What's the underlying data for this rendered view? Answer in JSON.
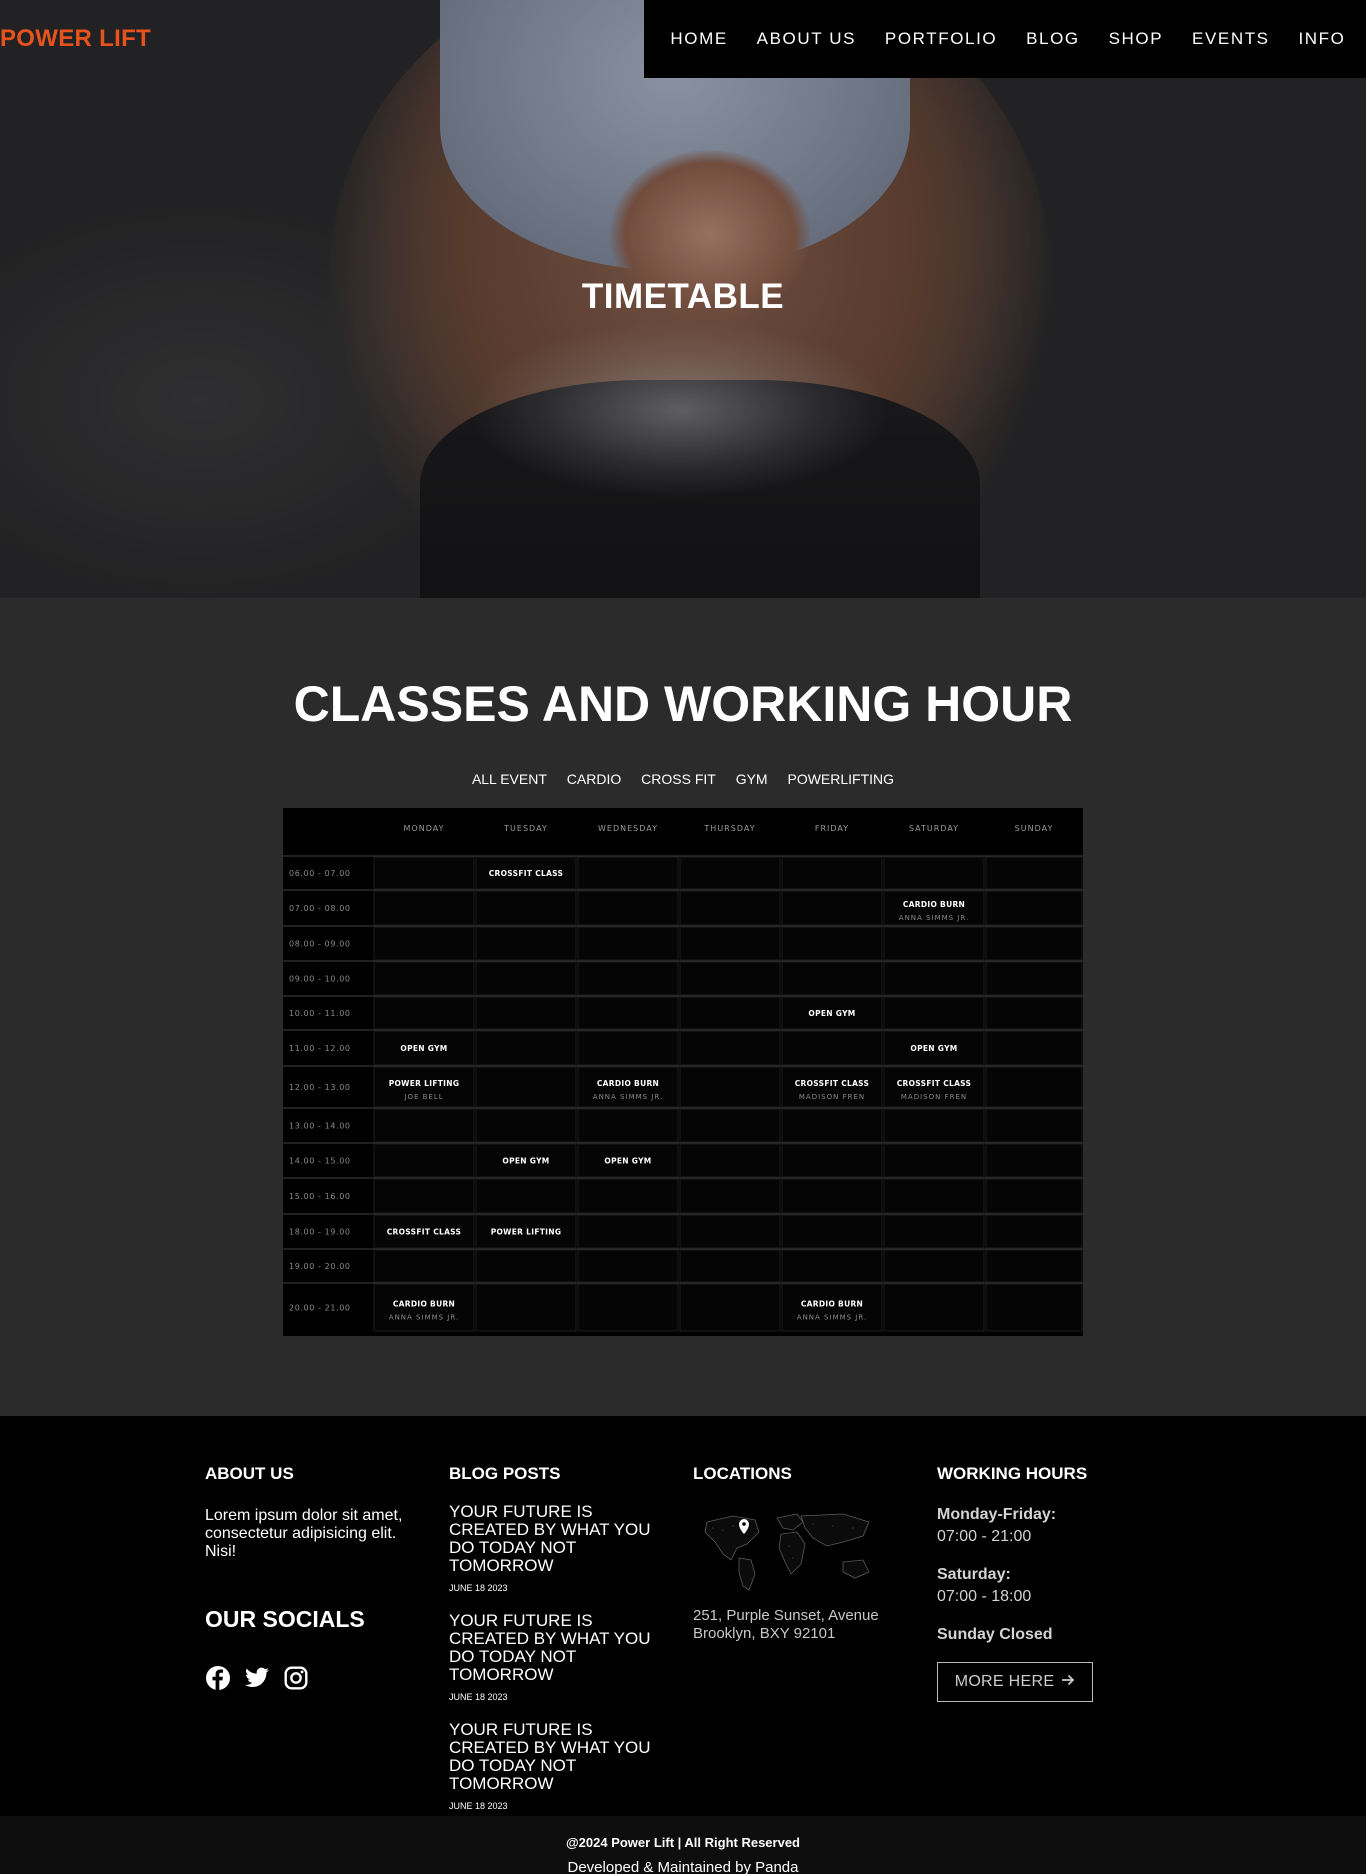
{
  "brand": {
    "logo": "POWER LIFT",
    "logo_color": "#e8531d"
  },
  "nav": {
    "items": [
      "HOME",
      "ABOUT US",
      "PORTFOLIO",
      "BLOG",
      "SHOP",
      "EVENTS",
      "INFO"
    ]
  },
  "hero": {
    "title": "TIMETABLE"
  },
  "section": {
    "title": "CLASSES AND WORKING HOUR"
  },
  "filters": [
    "ALL EVENT",
    "CARDIO",
    "CROSS FIT",
    "GYM",
    "POWERLIFTING"
  ],
  "timetable": {
    "days": [
      "MONDAY",
      "TUESDAY",
      "WEDNESDAY",
      "THURSDAY",
      "FRIDAY",
      "SATURDAY",
      "SUNDAY"
    ],
    "times": [
      "06.00 - 07.00",
      "07.00 - 08.00",
      "08.00 - 09.00",
      "09.00 - 10.00",
      "10.00 - 11.00",
      "11.00 - 12.00",
      "12.00 - 13.00",
      "13.00 - 14.00",
      "14.00 - 15.00",
      "15.00 - 16.00",
      "18.00 - 19.00",
      "19.00 - 20.00",
      "20.00 - 21.00"
    ],
    "events": [
      {
        "day": 1,
        "row": 0,
        "title": "CROSSFIT CLASS",
        "trainer": ""
      },
      {
        "day": 5,
        "row": 1,
        "title": "CARDIO BURN",
        "trainer": "ANNA SIMMS JR."
      },
      {
        "day": 4,
        "row": 4,
        "title": "OPEN GYM",
        "trainer": ""
      },
      {
        "day": 0,
        "row": 5,
        "title": "OPEN GYM",
        "trainer": ""
      },
      {
        "day": 5,
        "row": 5,
        "title": "OPEN GYM",
        "trainer": ""
      },
      {
        "day": 0,
        "row": 6,
        "title": "POWER LIFTING",
        "trainer": "JOE BELL"
      },
      {
        "day": 2,
        "row": 6,
        "title": "CARDIO BURN",
        "trainer": "ANNA SIMMS JR."
      },
      {
        "day": 4,
        "row": 6,
        "title": "CROSSFIT CLASS",
        "trainer": "MADISON FREN"
      },
      {
        "day": 5,
        "row": 6,
        "title": "CROSSFIT CLASS",
        "trainer": "MADISON FREN"
      },
      {
        "day": 1,
        "row": 8,
        "title": "OPEN GYM",
        "trainer": ""
      },
      {
        "day": 2,
        "row": 8,
        "title": "OPEN GYM",
        "trainer": ""
      },
      {
        "day": 0,
        "row": 10,
        "title": "CROSSFIT CLASS",
        "trainer": ""
      },
      {
        "day": 1,
        "row": 10,
        "title": "POWER LIFTING",
        "trainer": ""
      },
      {
        "day": 0,
        "row": 12,
        "title": "CARDIO BURN",
        "trainer": "ANNA SIMMS JR."
      },
      {
        "day": 4,
        "row": 12,
        "title": "CARDIO BURN",
        "trainer": "ANNA SIMMS JR."
      }
    ]
  },
  "footer": {
    "about": {
      "heading": "ABOUT US",
      "text": "Lorem ipsum dolor sit amet, consectetur adipisicing elit. Nisi!"
    },
    "socials": {
      "heading": "OUR SOCIALS",
      "icons": [
        "facebook-icon",
        "twitter-icon",
        "instagram-icon"
      ]
    },
    "blog": {
      "heading": "BLOG POSTS",
      "posts": [
        {
          "title": "YOUR FUTURE IS CREATED BY WHAT YOU DO TODAY NOT TOMORROW",
          "date": "JUNE 18 2023"
        },
        {
          "title": "YOUR FUTURE IS CREATED BY WHAT YOU DO TODAY NOT TOMORROW",
          "date": "JUNE 18 2023"
        },
        {
          "title": "YOUR FUTURE IS CREATED BY WHAT YOU DO TODAY NOT TOMORROW",
          "date": "JUNE 18 2023"
        }
      ]
    },
    "locations": {
      "heading": "LOCATIONS",
      "address": "251, Purple Sunset, Avenue Brooklyn, BXY 92101"
    },
    "hours": {
      "heading": "WORKING HOURS",
      "weekday_label": "Monday-Friday:",
      "weekday_time": "07:00 - 21:00",
      "saturday_label": "Saturday:",
      "saturday_time": "07:00 - 18:00",
      "sunday": "Sunday Closed",
      "button": "MORE HERE"
    },
    "copyright": "@2024 Power Lift | All Right Reserved",
    "developer": "Developed & Maintained by Panda"
  }
}
